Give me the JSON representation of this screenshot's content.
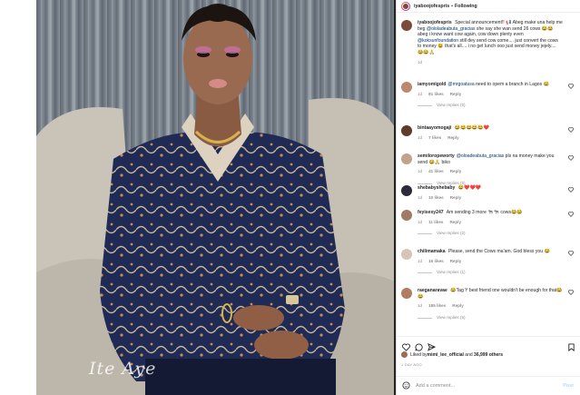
{
  "post": {
    "username": "iyaboojofespris",
    "follow_label": "Following",
    "separator": "•",
    "caption_user": "iyaboojofespris",
    "caption_text": " Special announcement!! 📢 Abeg make una help me beg",
    "caption_mention": " @ololadeabuta_gracias",
    "caption_text_2": " she say she wan send 26 cows 😂😂 abeg i know want cow again, cow down plenty even",
    "caption_mention_2": " @koksunfoundation",
    "caption_text_3": " still dey send cow come.... just convert the cows to money 😆 that's all.... i no get lunch ooo just send money jejely.... 😂😂🙏",
    "caption_time": "1d"
  },
  "watermark": "Ite Aye",
  "comments": [
    {
      "user": "iamyomigold",
      "mention": "@mrgoatusa",
      "text": " need to opem a branch in Lagos 😂",
      "time": "1d",
      "likes": "81 likes",
      "reply": "Reply",
      "replies": "View replies (5)"
    },
    {
      "user": "bintaayomogaji",
      "mention": "",
      "text": " 😂😂😂😂😂❤️",
      "time": "1d",
      "likes": "7 likes",
      "reply": "Reply",
      "replies": ""
    },
    {
      "user": "semiloropeworty",
      "mention": "@oloadeabuta_gracias",
      "text": " pls na money make you send 😂🙏 biko",
      "time": "1d",
      "likes": "41 likes",
      "reply": "Reply",
      "replies": "View replies (5)"
    },
    {
      "user": "shebabyshebaby",
      "mention": "",
      "text": " 😂❤️❤️❤️",
      "time": "1d",
      "likes": "10 likes",
      "reply": "Reply",
      "replies": ""
    },
    {
      "user": "feyisexy247",
      "mention": "",
      "text": " Am sending 3 more 🐄🐄 cows😂😂",
      "time": "1d",
      "likes": "11 likes",
      "reply": "Reply",
      "replies": "View replies (2)"
    },
    {
      "user": "chilimamaka",
      "mention": "",
      "text": " Please, send the Cows ma'am. God bless you 😂",
      "time": "1d",
      "likes": "16 likes",
      "reply": "Reply",
      "replies": "View replies (1)"
    },
    {
      "user": "raeganaravae",
      "mention": "",
      "text": " 😂Tag Y best friend one wouldn't be enough for that😂😂",
      "time": "1d",
      "likes": "185 likes",
      "reply": "Reply",
      "replies": "View replies (5)"
    }
  ],
  "likes": {
    "prefix": "Liked by ",
    "user": "mimi_lee_official",
    "middle": " and ",
    "count": "36,999 others"
  },
  "date": "1 DAY AGO",
  "add_comment": {
    "placeholder": "Add a comment...",
    "post_label": "Post"
  },
  "colors": {
    "link": "#00376b",
    "muted": "#8e8e8e",
    "post_disabled": "#b2dffc"
  }
}
